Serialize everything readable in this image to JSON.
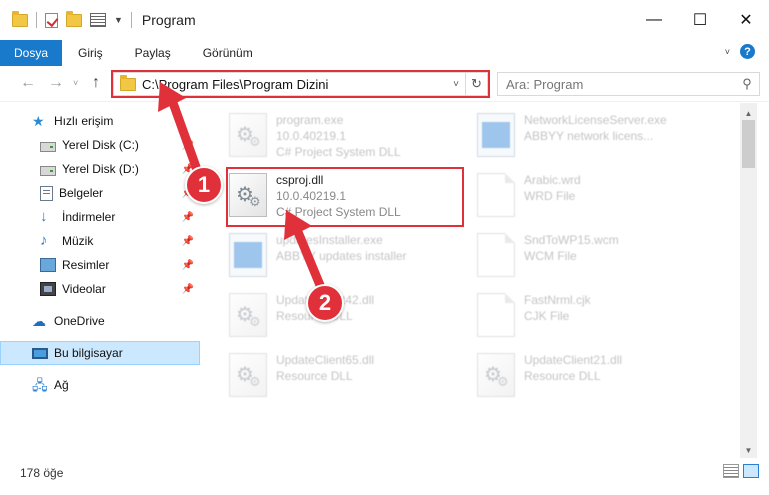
{
  "window": {
    "title": "Program"
  },
  "ribbon": {
    "file": "Dosya",
    "tabs": [
      "Giriş",
      "Paylaş",
      "Görünüm"
    ]
  },
  "nav": {
    "address": "C:\\Program Files\\Program Dizini",
    "search_placeholder": "Ara: Program"
  },
  "sidebar": {
    "quick_access": "Hızlı erişim",
    "items": [
      {
        "label": "Yerel Disk (C:)",
        "icon": "drive-icon",
        "pinned": true
      },
      {
        "label": "Yerel Disk (D:)",
        "icon": "drive-icon",
        "pinned": true
      },
      {
        "label": "Belgeler",
        "icon": "documents-icon",
        "pinned": true
      },
      {
        "label": "İndirmeler",
        "icon": "downloads-icon",
        "pinned": true
      },
      {
        "label": "Müzik",
        "icon": "music-icon",
        "pinned": true
      },
      {
        "label": "Resimler",
        "icon": "pictures-icon",
        "pinned": true
      },
      {
        "label": "Videolar",
        "icon": "videos-icon",
        "pinned": true
      }
    ],
    "onedrive": "OneDrive",
    "this_pc": "Bu bilgisayar",
    "network": "Ağ"
  },
  "files": [
    {
      "name": "program.exe",
      "line2": "10.0.40219.1",
      "line3": "C# Project System DLL",
      "icon": "dll-icon"
    },
    {
      "name": "NetworkLicenseServer.exe",
      "line2": "ABBYY network licens...",
      "line3": "",
      "icon": "app-icon"
    },
    {
      "name": "csproj.dll",
      "line2": "10.0.40219.1",
      "line3": "C# Project System DLL",
      "icon": "dll-icon"
    },
    {
      "name": "Arabic.wrd",
      "line2": "WRD File",
      "line3": "",
      "icon": "blank-icon"
    },
    {
      "name": "updatesInstaller.exe",
      "line2": "ABBYY updates installer",
      "line3": "",
      "icon": "app-icon"
    },
    {
      "name": "SndToWP15.wcm",
      "line2": "WCM File",
      "line3": "",
      "icon": "blank-icon"
    },
    {
      "name": "UpdateClient42.dll",
      "line2": "Resource DLL",
      "line3": "",
      "icon": "dll-icon"
    },
    {
      "name": "FastNrml.cjk",
      "line2": "CJK File",
      "line3": "",
      "icon": "blank-icon"
    },
    {
      "name": "UpdateClient65.dll",
      "line2": "Resource DLL",
      "line3": "",
      "icon": "dll-icon"
    },
    {
      "name": "UpdateClient21.dll",
      "line2": "Resource DLL",
      "line3": "",
      "icon": "dll-icon"
    }
  ],
  "status": {
    "count": "178 öğe"
  },
  "annotations": {
    "step1": "1",
    "step2": "2",
    "color": "#e0313a"
  }
}
